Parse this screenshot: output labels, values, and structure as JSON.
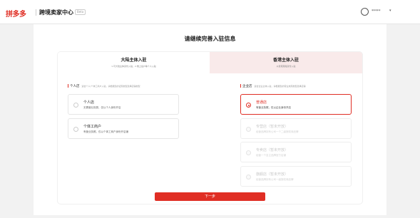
{
  "header": {
    "logo": "拼多多",
    "app_title": "跨境卖家中心",
    "beta_badge": "Beta",
    "user_name": "*****",
    "user_menu_icon": "chevron-down-icon",
    "avatar_icon": "user-avatar-icon"
  },
  "page": {
    "title": "请继续完善入驻信息"
  },
  "tabs": [
    {
      "label": "大陆主体入驻",
      "sub": "1.可大陆主体身份入驻，2.维上最户等个人入驻"
    },
    {
      "label": "香港主体入驻",
      "sub": "以香港港籍身份入驻"
    }
  ],
  "left_column": {
    "heading": "个人店",
    "hint": "适合个人/个体工商户入驻，请根据您的证照类型选择店铺类型",
    "options": [
      {
        "name": "个人店",
        "desc": "无需营业执照，仅以个人身份开店"
      },
      {
        "name": "个体工商户",
        "desc": "有营业执照，仅以个体工商户身份开店铺"
      }
    ]
  },
  "right_column": {
    "heading": "企业店",
    "hint": "适合企业主体入驻，请根据您的营业执照类型选择店铺",
    "options": [
      {
        "name": "普通店",
        "desc": "有营业执照，仅以企业身份开店",
        "selected": true
      },
      {
        "name": "专营店（暂未开放）",
        "desc": "经营品牌持有公司一个二级授权商品牌",
        "disabled": true
      },
      {
        "name": "专卖店（暂未开放）",
        "desc": "经营一个自主品牌官方店铺",
        "disabled": true
      },
      {
        "name": "旗舰店（暂未开放）",
        "desc": "经营品牌持有公司一级授权商品牌",
        "disabled": true
      }
    ]
  },
  "actions": {
    "next_label": "下一步"
  },
  "colors": {
    "brand_red": "#e02e24",
    "tab_active_bg": "#f9eaea"
  }
}
